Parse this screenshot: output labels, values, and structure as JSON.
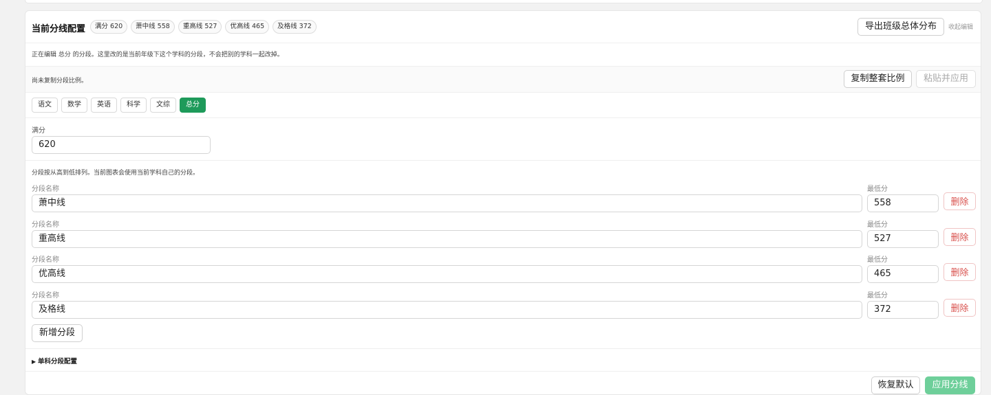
{
  "header": {
    "title": "当前分线配置",
    "badges": [
      "满分 620",
      "萧中线 558",
      "重高线 527",
      "优高线 465",
      "及格线 372"
    ],
    "export_label": "导出班级总体分布",
    "collapse_label": "收起编辑"
  },
  "editing_note": "正在编辑 总分 的分段。这里改的是当前年级下这个学科的分段，不会把别的学科一起改掉。",
  "copy_bar": {
    "status": "尚未复制分段比例。",
    "copy_label": "复制整套比例",
    "paste_label": "粘贴并应用"
  },
  "subjects": {
    "items": [
      "语文",
      "数学",
      "英语",
      "科学",
      "文综",
      "总分"
    ],
    "active": "总分"
  },
  "full_score": {
    "label": "满分",
    "value": "620"
  },
  "segments": {
    "hint": "分段按从高到低排列。当前图表会使用当前学科自己的分段。",
    "name_label": "分段名称",
    "min_label": "最低分",
    "delete_label": "删除",
    "rows": [
      {
        "name": "萧中线",
        "min": "558"
      },
      {
        "name": "重高线",
        "min": "527"
      },
      {
        "name": "优高线",
        "min": "465"
      },
      {
        "name": "及格线",
        "min": "372"
      }
    ],
    "add_label": "新增分段"
  },
  "single_subject": {
    "label": "单科分段配置"
  },
  "footer": {
    "reset_label": "恢复默认",
    "apply_label": "应用分线"
  },
  "colors": {
    "accent": "#1e9a5a",
    "danger": "#d9534f"
  }
}
